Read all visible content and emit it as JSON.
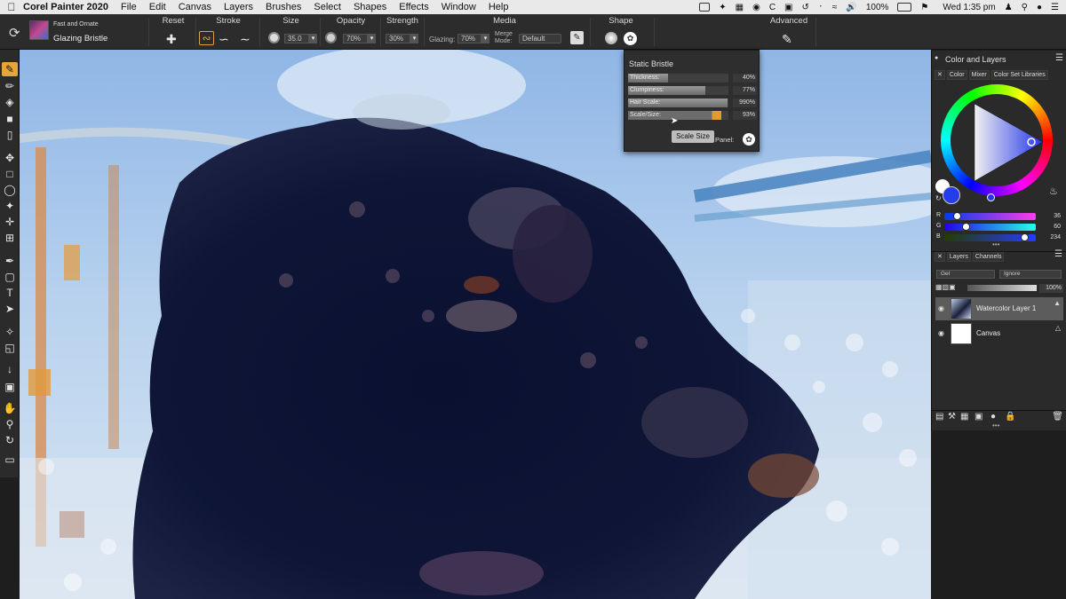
{
  "menubar": {
    "app_name": "Corel Painter 2020",
    "items": [
      "File",
      "Edit",
      "Canvas",
      "Layers",
      "Brushes",
      "Select",
      "Shapes",
      "Effects",
      "Window",
      "Help"
    ],
    "battery": "100%",
    "clock": "Wed 1:35 pm"
  },
  "propbar": {
    "brush_category": "Fast and Ornate",
    "brush_variant": "Glazing Bristle",
    "reset_label": "Reset",
    "stroke_label": "Stroke",
    "size_label": "Size",
    "size_value": "35.0",
    "opacity_label": "Opacity",
    "opacity_value": "70%",
    "strength_label": "Strength",
    "strength_value": "30%",
    "media_label": "Media",
    "glazing_label": "Glazing:",
    "glazing_value": "70%",
    "merge_mode_label": "Merge\nMode:",
    "merge_mode_value": "Default",
    "shape_label": "Shape",
    "advanced_label": "Advanced"
  },
  "bristle_panel": {
    "title": "Static Bristle",
    "rows": [
      {
        "label": "Thickness:",
        "value": "40%",
        "level": 0.4
      },
      {
        "label": "Clumpiness:",
        "value": "77%",
        "level": 0.77
      },
      {
        "label": "Hair Scale:",
        "value": "990%",
        "level": 0.99
      },
      {
        "label": "Scale/Size:",
        "value": "93%",
        "level": 0.93
      }
    ],
    "scale_size_button": "Scale Size",
    "panel_label": "Panel:"
  },
  "color_panel": {
    "title": "Color and Layers",
    "tabs": [
      "Color",
      "Mixer",
      "Color Set Libraries"
    ],
    "r_label": "R",
    "r_value": "36",
    "g_label": "G",
    "g_value": "60",
    "b_label": "B",
    "b_value": "234",
    "current_color": "#243cea"
  },
  "layers_panel": {
    "tabs": [
      "Layers",
      "Channels"
    ],
    "composite_method": "Gel",
    "composite_depth": "Ignore",
    "opacity": "100%",
    "layers": [
      {
        "name": "Watercolor Layer 1",
        "selected": true
      },
      {
        "name": "Canvas",
        "selected": false
      }
    ]
  }
}
